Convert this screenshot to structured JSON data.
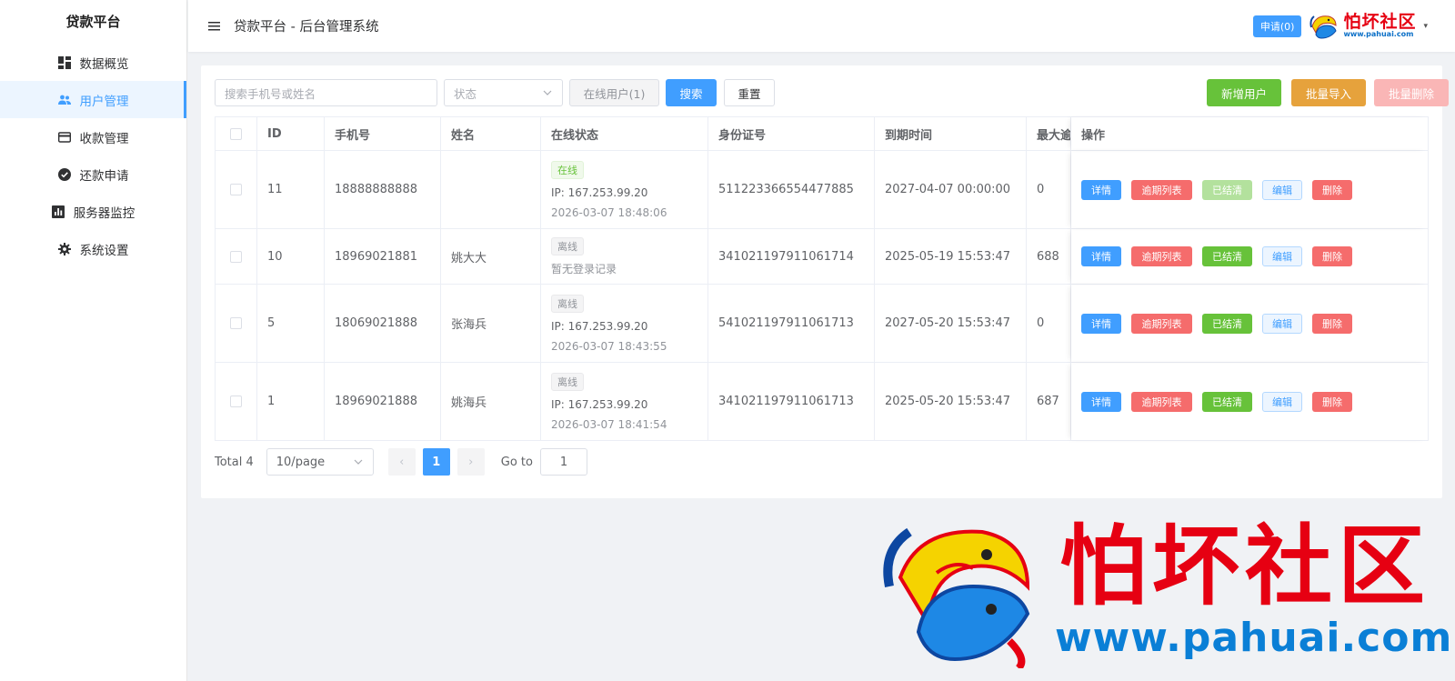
{
  "sidebar": {
    "brand": "贷款平台",
    "items": [
      {
        "label": "数据概览",
        "icon": "dashboard-icon"
      },
      {
        "label": "用户管理",
        "icon": "users-icon",
        "active": true
      },
      {
        "label": "收款管理",
        "icon": "credit-card-icon"
      },
      {
        "label": "还款申请",
        "icon": "check-circle-icon"
      },
      {
        "label": "服务器监控",
        "icon": "bar-chart-icon"
      },
      {
        "label": "系统设置",
        "icon": "gear-icon"
      }
    ]
  },
  "header": {
    "title": "贷款平台 - 后台管理系统",
    "apply_badge": "申请(0)",
    "logo_cn": "怕坏社区",
    "logo_url": "www.pahuai.com"
  },
  "toolbar": {
    "search_placeholder": "搜索手机号或姓名",
    "status_placeholder": "状态",
    "online_users": "在线用户(1)",
    "search": "搜索",
    "reset": "重置",
    "add_user": "新增用户",
    "batch_import": "批量导入",
    "batch_delete": "批量删除"
  },
  "table": {
    "headers": {
      "id": "ID",
      "phone": "手机号",
      "name": "姓名",
      "online": "在线状态",
      "idcard": "身份证号",
      "expire": "到期时间",
      "max": "最大逾",
      "ops": "操作"
    },
    "rows": [
      {
        "id": "11",
        "phone": "18888888888",
        "name": "",
        "status": "在线",
        "ip": "IP: 167.253.99.20",
        "login_time": "2026-03-07 18:48:06",
        "idcard": "511223366554477885",
        "expire": "2027-04-07 00:00:00",
        "max": "0"
      },
      {
        "id": "10",
        "phone": "18969021881",
        "name": "姚大大",
        "status": "离线",
        "ip": "",
        "login_time": "",
        "no_login": "暂无登录记录",
        "idcard": "341021197911061714",
        "expire": "2025-05-19 15:53:47",
        "max": "688"
      },
      {
        "id": "5",
        "phone": "18069021888",
        "name": "张海兵",
        "status": "离线",
        "ip": "IP: 167.253.99.20",
        "login_time": "2026-03-07 18:43:55",
        "idcard": "541021197911061713",
        "expire": "2027-05-20 15:53:47",
        "max": "0"
      },
      {
        "id": "1",
        "phone": "18969021888",
        "name": "姚海兵",
        "status": "离线",
        "ip": "IP: 167.253.99.20",
        "login_time": "2026-03-07 18:41:54",
        "idcard": "341021197911061713",
        "expire": "2025-05-20 15:53:47",
        "max": "687"
      }
    ],
    "ops": {
      "detail": "详情",
      "overdue_list": "逾期列表",
      "settled": "已结清",
      "edit": "编辑",
      "delete": "删除"
    }
  },
  "pagination": {
    "total": "Total 4",
    "page_size": "10/page",
    "current": "1",
    "goto_label": "Go to",
    "goto_value": "1"
  },
  "watermark": {
    "cn": "怕坏社区",
    "url": "www.pahuai.com"
  },
  "colors": {
    "primary": "#409eff",
    "success": "#67c23a",
    "warning": "#e6a23c",
    "danger": "#f56c6c",
    "logo_red": "#e60012",
    "logo_blue": "#0a7fd6"
  }
}
